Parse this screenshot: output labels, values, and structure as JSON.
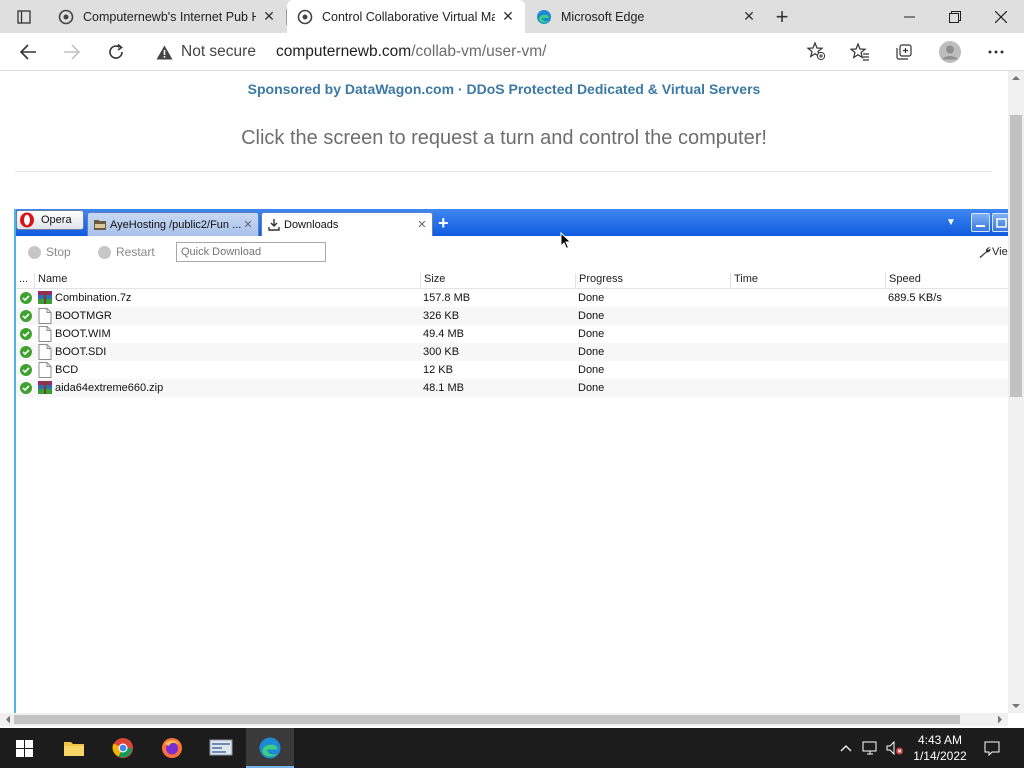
{
  "browser": {
    "tabs": [
      {
        "title": "Computernewb's Internet Pub H",
        "active": false
      },
      {
        "title": "Control Collaborative Virtual Ma",
        "active": true
      },
      {
        "title": "Microsoft Edge",
        "active": false
      }
    ],
    "security_label": "Not secure",
    "url_host": "computernewb.com",
    "url_path": "/collab-vm/user-vm/"
  },
  "page": {
    "sponsor_text": "Sponsored by DataWagon.com · DDoS Protected Dedicated & Virtual Servers",
    "instruction_text": "Click the screen to request a turn and control the computer!"
  },
  "vm": {
    "opera_button": "Opera",
    "tabs": [
      {
        "title": "AyeHosting /public2/Fun ..."
      },
      {
        "title": "Downloads"
      }
    ],
    "toolbar": {
      "stop": "Stop",
      "restart": "Restart",
      "quick_download_placeholder": "Quick Download",
      "view": "Vie"
    },
    "columns": {
      "status": "...",
      "name": "Name",
      "size": "Size",
      "progress": "Progress",
      "time": "Time",
      "speed": "Speed"
    },
    "downloads": [
      {
        "name": "Combination.7z",
        "size": "157.8 MB",
        "progress": "Done",
        "time": "",
        "speed": "689.5 KB/s",
        "icon": "archive-icon"
      },
      {
        "name": "BOOTMGR",
        "size": "326 KB",
        "progress": "Done",
        "time": "",
        "speed": "",
        "icon": "file-icon"
      },
      {
        "name": "BOOT.WIM",
        "size": "49.4 MB",
        "progress": "Done",
        "time": "",
        "speed": "",
        "icon": "file-icon"
      },
      {
        "name": "BOOT.SDI",
        "size": "300 KB",
        "progress": "Done",
        "time": "",
        "speed": "",
        "icon": "file-icon"
      },
      {
        "name": "BCD",
        "size": "12 KB",
        "progress": "Done",
        "time": "",
        "speed": "",
        "icon": "file-icon"
      },
      {
        "name": "aida64extreme660.zip",
        "size": "48.1 MB",
        "progress": "Done",
        "time": "",
        "speed": "",
        "icon": "archive-icon"
      }
    ]
  },
  "taskbar": {
    "time": "4:43 AM",
    "date": "1/14/2022"
  },
  "colors": {
    "sponsor_link": "#3c79a4",
    "opera_bar": "#1a63e4",
    "done_status": "#3fa22f",
    "taskbar": "#1c1c1c"
  }
}
